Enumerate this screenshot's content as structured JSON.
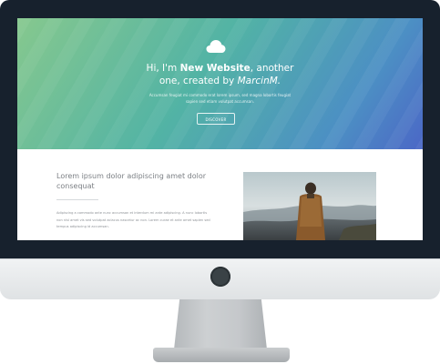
{
  "hero": {
    "title_prefix": "Hi, I'm ",
    "title_bold": "New Website",
    "title_middle": ", another",
    "title_line2": "one, created by ",
    "title_author": "MarcinM.",
    "subtitle": "Accumsan feugiat mi commodo erat lorem ipsum, sed magna lobortis feugiat sapien sed etiam volutpat accumsan.",
    "cta_label": "DISCOVER"
  },
  "content": {
    "heading": "Lorem ipsum dolor adipiscing amet dolor consequat",
    "body": "Adipiscing a commodo ante nunc accumsan et interdum mi ante adipiscing. A nunc lobortis non nisl amet vis sed volutpat aclacus nascetur ac non. Lorem curae et ante amet sapien sed tempus adipiscing id accumsan."
  },
  "colors": {
    "bezel": "#17212d",
    "hero_start": "#86c88e",
    "hero_end": "#4b67c6"
  },
  "icons": {
    "hero": "cloud-icon",
    "monitor": "power-button"
  }
}
